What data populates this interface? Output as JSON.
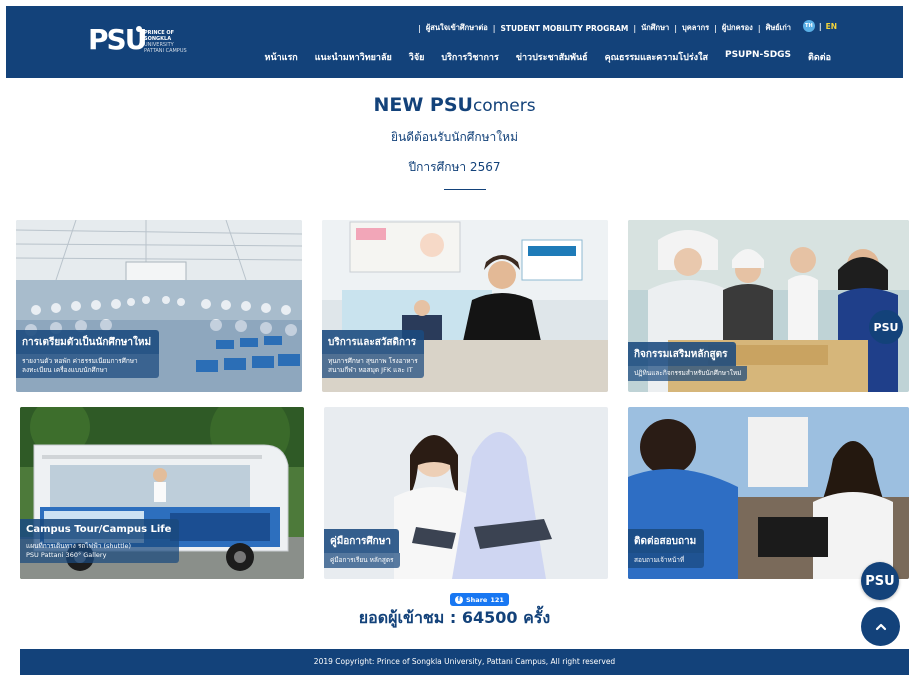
{
  "header": {
    "logo": {
      "mark": "PSU",
      "line1": "PRINCE OF",
      "line2": "SONGKLA",
      "line3": "UNIVERSITY",
      "line4": "PATTANI CAMPUS"
    },
    "top_links": [
      "ผู้สนใจเข้าศึกษาต่อ",
      "STUDENT MOBILITY PROGRAM",
      "นักศึกษา",
      "บุคลากร",
      "ผู้ปกครอง",
      "ศิษย์เก่า"
    ],
    "lang": {
      "th": "TH",
      "en": "EN"
    },
    "main_nav": [
      "หน้าแรก",
      "แนะนำมหาวิทยาลัย",
      "วิจัย",
      "บริการวิชาการ",
      "ข่าวประชาสัมพันธ์",
      "คุณธรรมและความโปร่งใส",
      "PSUPN-SDGS",
      "ติดต่อ"
    ]
  },
  "hero": {
    "title_bold": "NEW PSU",
    "title_thin": "comers",
    "subtitle": "ยินดีต้อนรับนักศึกษาใหม่",
    "year": "ปีการศึกษา 2567"
  },
  "cards": [
    {
      "title": "การเตรียมตัวเป็นนักศึกษาใหม่",
      "desc1": "รายงานตัว หอพัก ค่าธรรมเนียมการศึกษา",
      "desc2": "ลงทะเบียน เครื่องแบบนักศึกษา"
    },
    {
      "title": "บริการและสวัสดิการ",
      "desc1": "ทุนการศึกษา สุขภาพ โรงอาหาร",
      "desc2": "สนามกีฬา หอสมุด JFK และ IT"
    },
    {
      "title": "กิจกรรมเสริมหลักสูตร",
      "desc1": "ปฏิทินและกิจกรรมสำหรับนักศึกษาใหม่",
      "desc2": ""
    },
    {
      "title": "Campus Tour/Campus Life",
      "desc1": "แผนที่การเดินทาง รถไฟฟ้า (shuttle)",
      "desc2": "PSU Pattani 360° Gallery"
    },
    {
      "title": "คู่มือการศึกษา",
      "desc1": "คู่มือการเรียน หลักสูตร",
      "desc2": ""
    },
    {
      "title": "ติดต่อสอบถาม",
      "desc1": "สอบถามเจ้าหน้าที่",
      "desc2": ""
    }
  ],
  "share": {
    "label": "Share",
    "count": "121"
  },
  "visits": "ยอดผู้เข้าชม : 64500 ครั้ง",
  "footer": "2019 Copyright: Prince of Songkla University, Pattani Campus, All right reserved",
  "float_logo": "PSU",
  "colors": {
    "brand": "#13427a",
    "accent": "#f2d33a",
    "facebook": "#1877f2"
  }
}
